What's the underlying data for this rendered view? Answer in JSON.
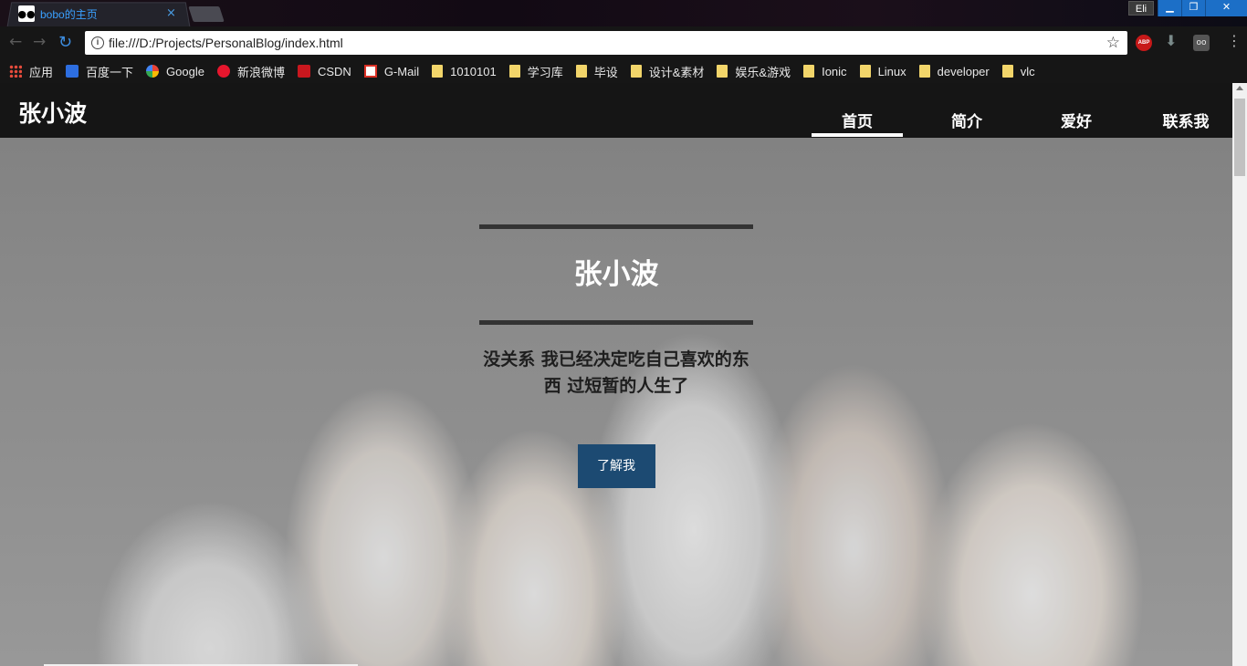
{
  "browser": {
    "tab_title": "bobo的主页",
    "tab_close": "×",
    "user_badge": "Eli",
    "url": "file:///D:/Projects/PersonalBlog/index.html",
    "extensions": {
      "abp": "ABP",
      "ext3": "oo"
    }
  },
  "bookmarks": [
    {
      "label": "应用",
      "icon": "apps-icon"
    },
    {
      "label": "百度一下",
      "icon": "baidu-icon"
    },
    {
      "label": "Google",
      "icon": "google-icon"
    },
    {
      "label": "新浪微博",
      "icon": "weibo-icon"
    },
    {
      "label": "CSDN",
      "icon": "csdn-icon"
    },
    {
      "label": "G-Mail",
      "icon": "gmail-icon"
    },
    {
      "label": "1010101",
      "icon": "folder-icon"
    },
    {
      "label": "学习库",
      "icon": "folder-icon"
    },
    {
      "label": "毕设",
      "icon": "folder-icon"
    },
    {
      "label": "设计&素材",
      "icon": "folder-icon"
    },
    {
      "label": "娱乐&游戏",
      "icon": "folder-icon"
    },
    {
      "label": "Ionic",
      "icon": "folder-icon"
    },
    {
      "label": "Linux",
      "icon": "folder-icon"
    },
    {
      "label": "developer",
      "icon": "folder-icon"
    },
    {
      "label": "vlc",
      "icon": "folder-icon"
    }
  ],
  "site": {
    "brand": "张小波",
    "nav": [
      {
        "label": "首页",
        "active": true
      },
      {
        "label": "简介",
        "active": false
      },
      {
        "label": "爱好",
        "active": false
      },
      {
        "label": "联系我",
        "active": false
      }
    ],
    "hero": {
      "title": "张小波",
      "subtitle": "没关系 我已经决定吃自己喜欢的东西 过短暂的人生了",
      "button": "了解我"
    }
  }
}
